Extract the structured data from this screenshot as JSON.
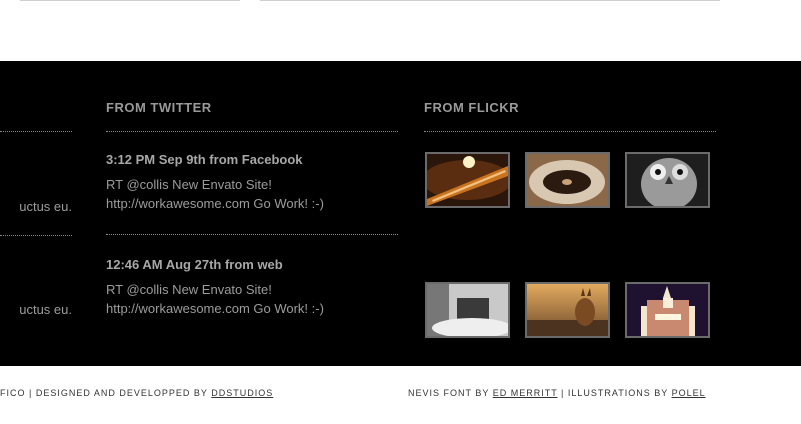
{
  "left_column": {
    "snippets": [
      "uctus eu.",
      "uctus eu."
    ]
  },
  "twitter": {
    "heading": "FROM TWITTER",
    "tweets": [
      {
        "time": "3:12 PM Sep 9th from Facebook",
        "line1": "RT @collis New Envato Site!",
        "line2": "http://workawesome.com Go Work! :-)"
      },
      {
        "time": "12:46 AM Aug 27th from web",
        "line1": "RT @collis New Envato Site!",
        "line2": "http://workawesome.com Go Work! :-)"
      }
    ]
  },
  "flickr": {
    "heading": "FROM FLICKR",
    "photos": [
      "guitar-photo",
      "vinyl-record-photo",
      "owl-photo",
      "boat-in-fog-photo",
      "deer-photo",
      "church-at-night-photo"
    ]
  },
  "footer": {
    "left_prefix": "FICO  |  DESIGNED AND DEVELOPPED BY ",
    "left_link": "DDSTUDIOS",
    "right_prefix": "NEVIS FONT BY ",
    "right_link1": "ED MERRITT",
    "right_middle": " | ILLUSTRATIONS BY ",
    "right_link2": "POLEL"
  }
}
